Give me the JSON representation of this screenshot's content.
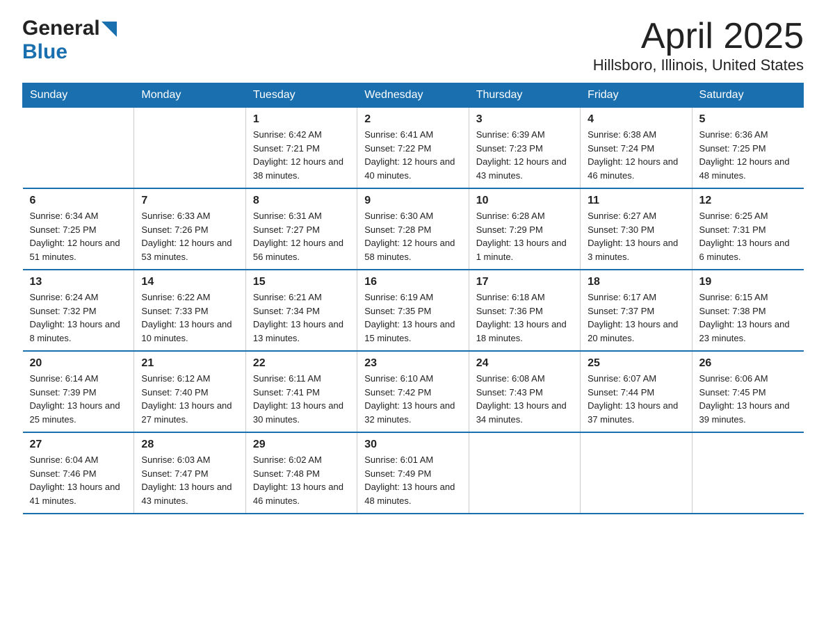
{
  "header": {
    "logo_general": "General",
    "logo_blue": "Blue",
    "month_title": "April 2025",
    "location": "Hillsboro, Illinois, United States"
  },
  "days_of_week": [
    "Sunday",
    "Monday",
    "Tuesday",
    "Wednesday",
    "Thursday",
    "Friday",
    "Saturday"
  ],
  "weeks": [
    [
      {
        "day": "",
        "sunrise": "",
        "sunset": "",
        "daylight": ""
      },
      {
        "day": "",
        "sunrise": "",
        "sunset": "",
        "daylight": ""
      },
      {
        "day": "1",
        "sunrise": "Sunrise: 6:42 AM",
        "sunset": "Sunset: 7:21 PM",
        "daylight": "Daylight: 12 hours and 38 minutes."
      },
      {
        "day": "2",
        "sunrise": "Sunrise: 6:41 AM",
        "sunset": "Sunset: 7:22 PM",
        "daylight": "Daylight: 12 hours and 40 minutes."
      },
      {
        "day": "3",
        "sunrise": "Sunrise: 6:39 AM",
        "sunset": "Sunset: 7:23 PM",
        "daylight": "Daylight: 12 hours and 43 minutes."
      },
      {
        "day": "4",
        "sunrise": "Sunrise: 6:38 AM",
        "sunset": "Sunset: 7:24 PM",
        "daylight": "Daylight: 12 hours and 46 minutes."
      },
      {
        "day": "5",
        "sunrise": "Sunrise: 6:36 AM",
        "sunset": "Sunset: 7:25 PM",
        "daylight": "Daylight: 12 hours and 48 minutes."
      }
    ],
    [
      {
        "day": "6",
        "sunrise": "Sunrise: 6:34 AM",
        "sunset": "Sunset: 7:25 PM",
        "daylight": "Daylight: 12 hours and 51 minutes."
      },
      {
        "day": "7",
        "sunrise": "Sunrise: 6:33 AM",
        "sunset": "Sunset: 7:26 PM",
        "daylight": "Daylight: 12 hours and 53 minutes."
      },
      {
        "day": "8",
        "sunrise": "Sunrise: 6:31 AM",
        "sunset": "Sunset: 7:27 PM",
        "daylight": "Daylight: 12 hours and 56 minutes."
      },
      {
        "day": "9",
        "sunrise": "Sunrise: 6:30 AM",
        "sunset": "Sunset: 7:28 PM",
        "daylight": "Daylight: 12 hours and 58 minutes."
      },
      {
        "day": "10",
        "sunrise": "Sunrise: 6:28 AM",
        "sunset": "Sunset: 7:29 PM",
        "daylight": "Daylight: 13 hours and 1 minute."
      },
      {
        "day": "11",
        "sunrise": "Sunrise: 6:27 AM",
        "sunset": "Sunset: 7:30 PM",
        "daylight": "Daylight: 13 hours and 3 minutes."
      },
      {
        "day": "12",
        "sunrise": "Sunrise: 6:25 AM",
        "sunset": "Sunset: 7:31 PM",
        "daylight": "Daylight: 13 hours and 6 minutes."
      }
    ],
    [
      {
        "day": "13",
        "sunrise": "Sunrise: 6:24 AM",
        "sunset": "Sunset: 7:32 PM",
        "daylight": "Daylight: 13 hours and 8 minutes."
      },
      {
        "day": "14",
        "sunrise": "Sunrise: 6:22 AM",
        "sunset": "Sunset: 7:33 PM",
        "daylight": "Daylight: 13 hours and 10 minutes."
      },
      {
        "day": "15",
        "sunrise": "Sunrise: 6:21 AM",
        "sunset": "Sunset: 7:34 PM",
        "daylight": "Daylight: 13 hours and 13 minutes."
      },
      {
        "day": "16",
        "sunrise": "Sunrise: 6:19 AM",
        "sunset": "Sunset: 7:35 PM",
        "daylight": "Daylight: 13 hours and 15 minutes."
      },
      {
        "day": "17",
        "sunrise": "Sunrise: 6:18 AM",
        "sunset": "Sunset: 7:36 PM",
        "daylight": "Daylight: 13 hours and 18 minutes."
      },
      {
        "day": "18",
        "sunrise": "Sunrise: 6:17 AM",
        "sunset": "Sunset: 7:37 PM",
        "daylight": "Daylight: 13 hours and 20 minutes."
      },
      {
        "day": "19",
        "sunrise": "Sunrise: 6:15 AM",
        "sunset": "Sunset: 7:38 PM",
        "daylight": "Daylight: 13 hours and 23 minutes."
      }
    ],
    [
      {
        "day": "20",
        "sunrise": "Sunrise: 6:14 AM",
        "sunset": "Sunset: 7:39 PM",
        "daylight": "Daylight: 13 hours and 25 minutes."
      },
      {
        "day": "21",
        "sunrise": "Sunrise: 6:12 AM",
        "sunset": "Sunset: 7:40 PM",
        "daylight": "Daylight: 13 hours and 27 minutes."
      },
      {
        "day": "22",
        "sunrise": "Sunrise: 6:11 AM",
        "sunset": "Sunset: 7:41 PM",
        "daylight": "Daylight: 13 hours and 30 minutes."
      },
      {
        "day": "23",
        "sunrise": "Sunrise: 6:10 AM",
        "sunset": "Sunset: 7:42 PM",
        "daylight": "Daylight: 13 hours and 32 minutes."
      },
      {
        "day": "24",
        "sunrise": "Sunrise: 6:08 AM",
        "sunset": "Sunset: 7:43 PM",
        "daylight": "Daylight: 13 hours and 34 minutes."
      },
      {
        "day": "25",
        "sunrise": "Sunrise: 6:07 AM",
        "sunset": "Sunset: 7:44 PM",
        "daylight": "Daylight: 13 hours and 37 minutes."
      },
      {
        "day": "26",
        "sunrise": "Sunrise: 6:06 AM",
        "sunset": "Sunset: 7:45 PM",
        "daylight": "Daylight: 13 hours and 39 minutes."
      }
    ],
    [
      {
        "day": "27",
        "sunrise": "Sunrise: 6:04 AM",
        "sunset": "Sunset: 7:46 PM",
        "daylight": "Daylight: 13 hours and 41 minutes."
      },
      {
        "day": "28",
        "sunrise": "Sunrise: 6:03 AM",
        "sunset": "Sunset: 7:47 PM",
        "daylight": "Daylight: 13 hours and 43 minutes."
      },
      {
        "day": "29",
        "sunrise": "Sunrise: 6:02 AM",
        "sunset": "Sunset: 7:48 PM",
        "daylight": "Daylight: 13 hours and 46 minutes."
      },
      {
        "day": "30",
        "sunrise": "Sunrise: 6:01 AM",
        "sunset": "Sunset: 7:49 PM",
        "daylight": "Daylight: 13 hours and 48 minutes."
      },
      {
        "day": "",
        "sunrise": "",
        "sunset": "",
        "daylight": ""
      },
      {
        "day": "",
        "sunrise": "",
        "sunset": "",
        "daylight": ""
      },
      {
        "day": "",
        "sunrise": "",
        "sunset": "",
        "daylight": ""
      }
    ]
  ]
}
